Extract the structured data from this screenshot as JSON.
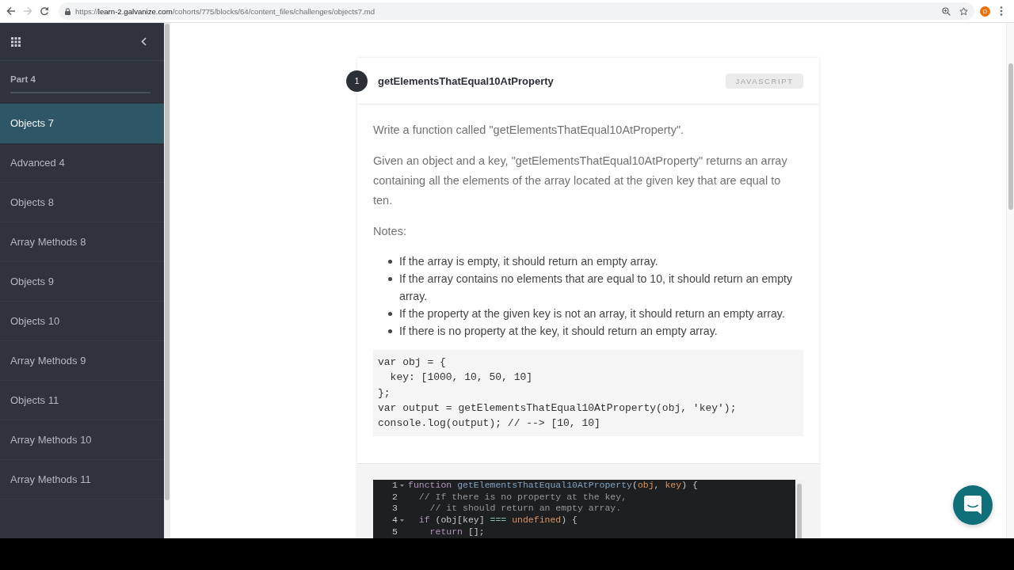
{
  "browser": {
    "back_disabled": false,
    "forward_disabled": true,
    "url": {
      "scheme": "https://",
      "host": "learn-2.galvanize.com",
      "path": "/cohorts/775/blocks/64/content_files/challenges/objects7.md"
    },
    "profile_initial": "D"
  },
  "sidebar": {
    "section": "Part 4",
    "items": [
      {
        "label": "Objects 7",
        "selected": true
      },
      {
        "label": "Advanced 4",
        "selected": false
      },
      {
        "label": "Objects 8",
        "selected": false
      },
      {
        "label": "Array Methods 8",
        "selected": false
      },
      {
        "label": "Objects 9",
        "selected": false
      },
      {
        "label": "Objects 10",
        "selected": false
      },
      {
        "label": "Array Methods 9",
        "selected": false
      },
      {
        "label": "Objects 11",
        "selected": false
      },
      {
        "label": "Array Methods 10",
        "selected": false
      },
      {
        "label": "Array Methods 11",
        "selected": false
      }
    ]
  },
  "challenge": {
    "number": "1",
    "title": "getElementsThatEqual10AtProperty",
    "language": "JAVASCRIPT",
    "paragraphs": [
      "Write a function called \"getElementsThatEqual10AtProperty\".",
      "Given an object and a key, \"getElementsThatEqual10AtProperty\" returns an array containing all the elements of the array located at the given key that are equal to ten.",
      "Notes:"
    ],
    "notes": [
      "If the array is empty, it should return an empty array.",
      "If the array contains no elements that are equal to 10, it should return an empty array.",
      "If the property at the given key is not an array, it should return an empty array.",
      "If there is no property at the key, it should return an empty array."
    ],
    "example_code": [
      "var obj = {",
      "  key: [1000, 10, 50, 10]",
      "};",
      "var output = getElementsThatEqual10AtProperty(obj, 'key');",
      "console.log(output); // --> [10, 10]"
    ]
  },
  "editor": {
    "lines": [
      {
        "number": "1",
        "foldable": true,
        "tokens": [
          {
            "kind": "keyword",
            "text": "function "
          },
          {
            "kind": "function",
            "text": "getElementsThatEqual10AtProperty"
          },
          {
            "kind": "plain",
            "text": "("
          },
          {
            "kind": "param",
            "text": "obj"
          },
          {
            "kind": "plain",
            "text": ", "
          },
          {
            "kind": "param",
            "text": "key"
          },
          {
            "kind": "plain",
            "text": ") {"
          }
        ]
      },
      {
        "number": "2",
        "foldable": false,
        "tokens": [
          {
            "kind": "comment",
            "text": "  // If there is no property at the key,"
          }
        ]
      },
      {
        "number": "3",
        "foldable": false,
        "tokens": [
          {
            "kind": "comment",
            "text": "    // it should return an empty array."
          }
        ]
      },
      {
        "number": "4",
        "foldable": true,
        "tokens": [
          {
            "kind": "keyword",
            "text": "  if"
          },
          {
            "kind": "plain",
            "text": " (obj[key] "
          },
          {
            "kind": "operator",
            "text": "==="
          },
          {
            "kind": "constant",
            "text": " undefined"
          },
          {
            "kind": "plain",
            "text": ") {"
          }
        ]
      },
      {
        "number": "5",
        "foldable": false,
        "tokens": [
          {
            "kind": "keyword",
            "text": "    return"
          },
          {
            "kind": "plain",
            "text": " [];"
          }
        ]
      }
    ]
  }
}
